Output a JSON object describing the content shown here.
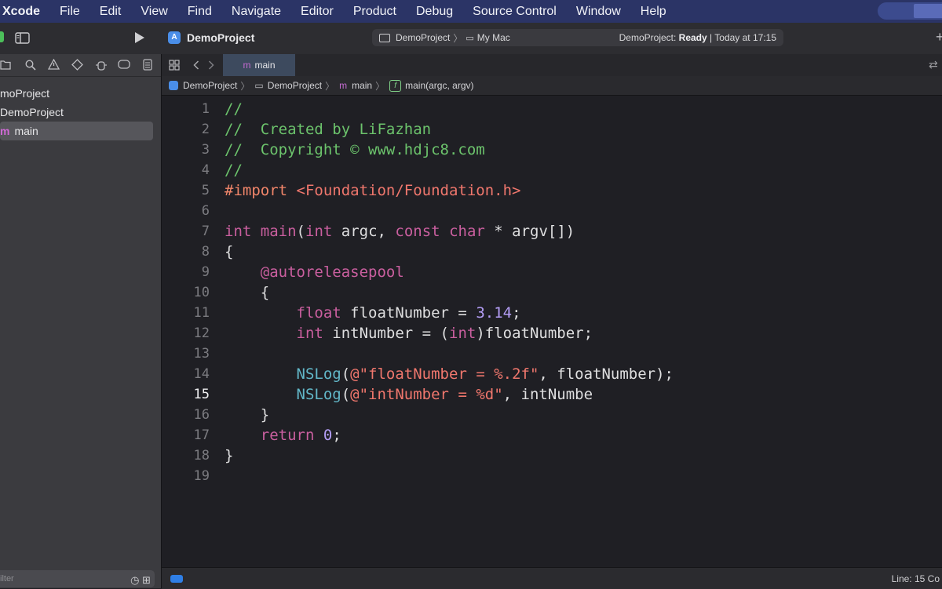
{
  "menubar": {
    "app": "Xcode",
    "items": [
      "File",
      "Edit",
      "View",
      "Find",
      "Navigate",
      "Editor",
      "Product",
      "Debug",
      "Source Control",
      "Window",
      "Help"
    ]
  },
  "toolbar": {
    "project_title": "DemoProject",
    "scheme": "DemoProject",
    "destination": "My Mac",
    "status_prefix": "DemoProject: ",
    "status_state": "Ready",
    "status_suffix": " | Today at 17:15"
  },
  "navigator": {
    "items": [
      {
        "label": "moProject"
      },
      {
        "label": "DemoProject"
      },
      {
        "label": "main",
        "glyph": "m"
      }
    ],
    "filter_placeholder": "ilter"
  },
  "tabs": [
    {
      "label": "main",
      "glyph": "m"
    }
  ],
  "jumpbar": {
    "items": [
      "DemoProject",
      "DemoProject",
      "main",
      "main(argc, argv)"
    ],
    "glyphs": {
      "m": "m",
      "f": "f"
    }
  },
  "editor": {
    "current_line": 15,
    "lines": [
      {
        "n": "1",
        "tokens": [
          {
            "t": "//",
            "c": "comment"
          }
        ]
      },
      {
        "n": "2",
        "tokens": [
          {
            "t": "//  Created by LiFazhan",
            "c": "comment"
          }
        ]
      },
      {
        "n": "3",
        "tokens": [
          {
            "t": "//  Copyright © www.hdjc8.com",
            "c": "comment"
          }
        ]
      },
      {
        "n": "4",
        "tokens": [
          {
            "t": "//",
            "c": "comment"
          }
        ]
      },
      {
        "n": "5",
        "tokens": [
          {
            "t": "#import ",
            "c": "pp"
          },
          {
            "t": "<Foundation/Foundation.h>",
            "c": "str"
          }
        ]
      },
      {
        "n": "6",
        "tokens": []
      },
      {
        "n": "7",
        "tokens": [
          {
            "t": "int",
            "c": "kw"
          },
          {
            "t": " "
          },
          {
            "t": "main",
            "c": "kw"
          },
          {
            "t": "("
          },
          {
            "t": "int",
            "c": "kw"
          },
          {
            "t": " argc, "
          },
          {
            "t": "const",
            "c": "kw"
          },
          {
            "t": " "
          },
          {
            "t": "char",
            "c": "kw"
          },
          {
            "t": " * argv[])"
          }
        ]
      },
      {
        "n": "8",
        "tokens": [
          {
            "t": "{"
          }
        ]
      },
      {
        "n": "9",
        "tokens": [
          {
            "t": "    "
          },
          {
            "t": "@autoreleasepool",
            "c": "kw"
          }
        ]
      },
      {
        "n": "10",
        "tokens": [
          {
            "t": "    {"
          }
        ]
      },
      {
        "n": "11",
        "tokens": [
          {
            "t": "        "
          },
          {
            "t": "float",
            "c": "kw"
          },
          {
            "t": " floatNumber = "
          },
          {
            "t": "3.14",
            "c": "num"
          },
          {
            "t": ";"
          }
        ]
      },
      {
        "n": "12",
        "tokens": [
          {
            "t": "        "
          },
          {
            "t": "int",
            "c": "kw"
          },
          {
            "t": " intNumber = ("
          },
          {
            "t": "int",
            "c": "kw"
          },
          {
            "t": ")floatNumber;"
          }
        ]
      },
      {
        "n": "13",
        "tokens": []
      },
      {
        "n": "14",
        "tokens": [
          {
            "t": "        "
          },
          {
            "t": "NSLog",
            "c": "fn"
          },
          {
            "t": "("
          },
          {
            "t": "@\"floatNumber = %.2f\"",
            "c": "str"
          },
          {
            "t": ", floatNumber);"
          }
        ]
      },
      {
        "n": "15",
        "tokens": [
          {
            "t": "        "
          },
          {
            "t": "NSLog",
            "c": "fn"
          },
          {
            "t": "("
          },
          {
            "t": "@\"intNumber = %d\"",
            "c": "str"
          },
          {
            "t": ", intNumbe"
          }
        ]
      },
      {
        "n": "16",
        "tokens": [
          {
            "t": "    }"
          }
        ]
      },
      {
        "n": "17",
        "tokens": [
          {
            "t": "    "
          },
          {
            "t": "return",
            "c": "kw"
          },
          {
            "t": " "
          },
          {
            "t": "0",
            "c": "num"
          },
          {
            "t": ";"
          }
        ]
      },
      {
        "n": "18",
        "tokens": [
          {
            "t": "}"
          }
        ]
      },
      {
        "n": "19",
        "tokens": []
      }
    ]
  },
  "statusbar": {
    "cursor": "Line: 15  Co"
  },
  "colors": {
    "menubar_bg": "#2b3466",
    "comment": "#6cc36c",
    "keyword": "#ca5f9f",
    "preprocessor": "#f2866a",
    "string": "#f0776d",
    "number": "#b49ef6",
    "function": "#62b7c8"
  },
  "icons": {
    "run": "play-icon",
    "sidebar_toggle": "sidebar-toggle-icon",
    "grid": "grid-icon",
    "back": "chevron-left-icon",
    "forward": "chevron-right-icon",
    "filters": [
      "folder-icon",
      "search-icon",
      "warning-icon",
      "diamond-icon",
      "debug-icon",
      "tag-icon",
      "list-icon"
    ]
  }
}
